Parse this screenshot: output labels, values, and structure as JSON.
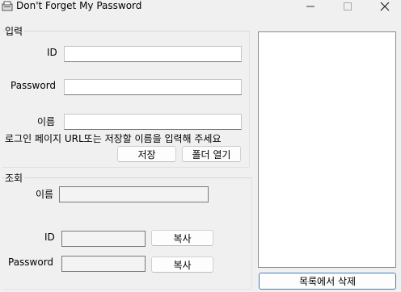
{
  "window": {
    "title": "Don't Forget My Password"
  },
  "input_group": {
    "title": "입력",
    "id_label": "ID",
    "id_value": "",
    "password_label": "Password",
    "password_value": "",
    "name_label": "이름",
    "name_value": "",
    "hint": "로그인 페이지 URL또는 저장할 이름을 입력해 주세요",
    "save_label": "저장",
    "open_folder_label": "폴더 열기"
  },
  "lookup_group": {
    "title": "조회",
    "name_label": "이름",
    "name_value": "",
    "id_label": "ID",
    "id_value": "",
    "id_copy_label": "복사",
    "password_label": "Password",
    "password_value": "",
    "password_copy_label": "복사"
  },
  "list": {
    "items": [],
    "delete_label": "목록에서 삭제"
  }
}
